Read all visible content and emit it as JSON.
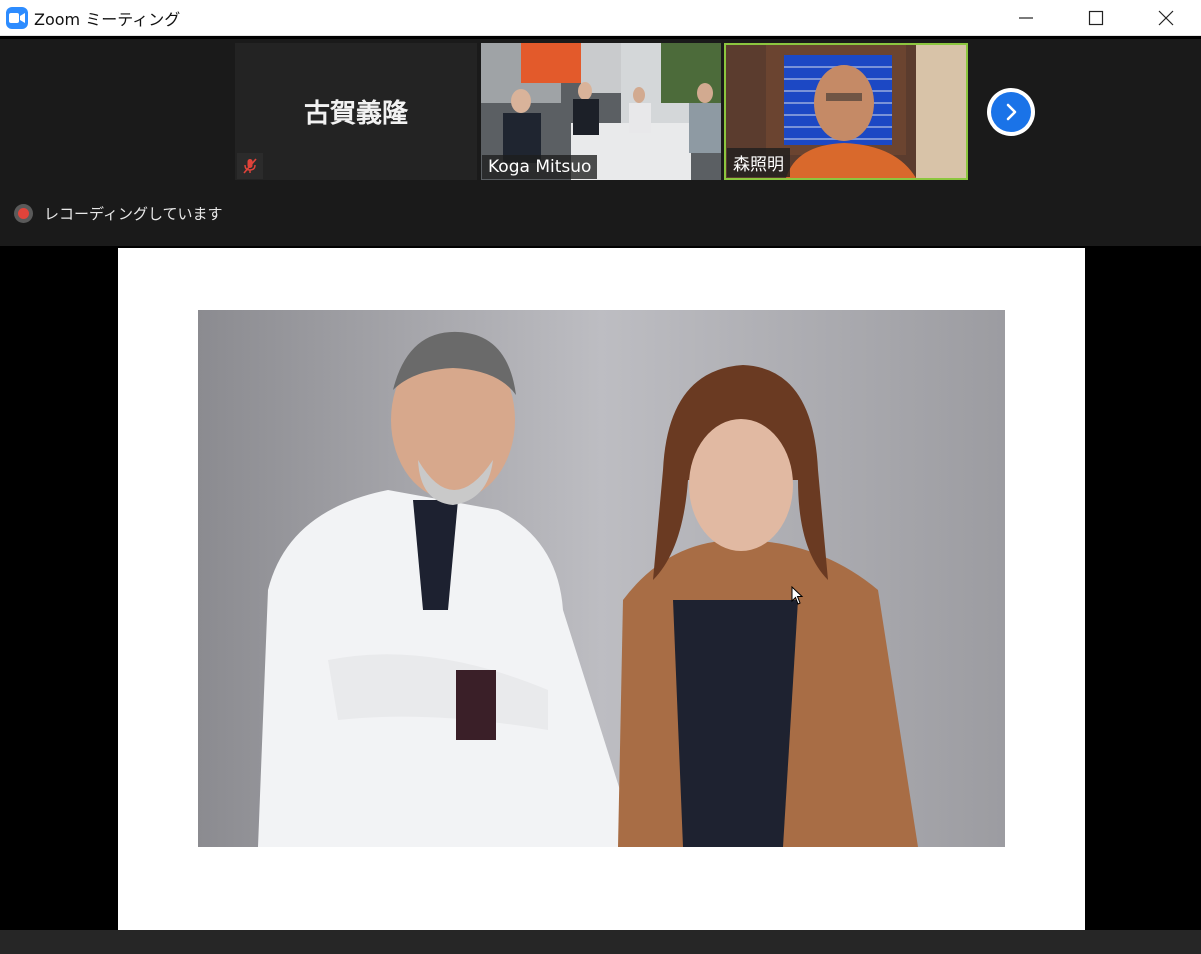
{
  "window": {
    "title": "Zoom ミーティング",
    "icon": "zoom-camera-icon"
  },
  "participants": [
    {
      "name": "古賀義隆",
      "video": false,
      "muted": true
    },
    {
      "name": "Koga Mitsuo",
      "video": true
    },
    {
      "name": "森照明",
      "video": true,
      "active_speaker": true
    }
  ],
  "strip": {
    "next_icon": "chevron-right-icon"
  },
  "recording": {
    "label": "レコーディングしています"
  },
  "colors": {
    "active_speaker_border": "#8cc63f",
    "next_button": "#1a73e8",
    "recording_dot": "#e0433a",
    "zoom_brand": "#2d8cff"
  }
}
